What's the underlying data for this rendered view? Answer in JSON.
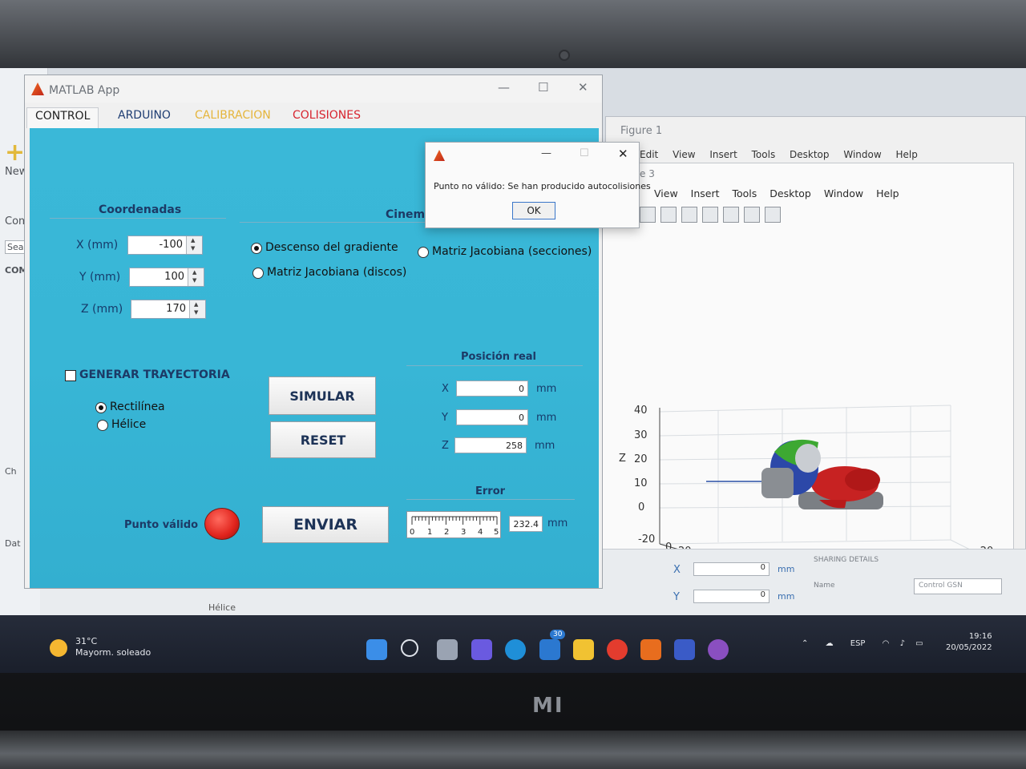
{
  "app": {
    "title": "MATLAB App",
    "tabs": [
      "CONTROL",
      "ARDUINO",
      "CALIBRACION",
      "COLISIONES"
    ],
    "coords": {
      "header": "Coordenadas",
      "x_label": "X (mm)",
      "x_value": "-100",
      "y_label": "Y (mm)",
      "y_value": "100",
      "z_label": "Z (mm)",
      "z_value": "170"
    },
    "cinematica": {
      "header": "Cinema",
      "opt1": "Descenso del gradiente",
      "opt2": "Matriz Jacobiana (discos)",
      "opt3": "Matriz Jacobiana (secciones)"
    },
    "trayectoria": {
      "label": "GENERAR TRAYECTORIA",
      "opt1": "Rectilínea",
      "opt2": "Hélice"
    },
    "buttons": {
      "simular": "SIMULAR",
      "reset": "RESET",
      "enviar": "ENVIAR"
    },
    "posicion": {
      "header": "Posición real",
      "x_label": "X",
      "x_value": "0",
      "y_label": "Y",
      "y_value": "0",
      "z_label": "Z",
      "z_value": "258",
      "unit": "mm"
    },
    "error": {
      "header": "Error",
      "value": "232.4",
      "unit": "mm",
      "ticks": [
        "0",
        "1",
        "2",
        "3",
        "4",
        "5"
      ]
    },
    "punto_valido": "Punto válido",
    "led_color": "#e0231c"
  },
  "dialog": {
    "message": "Punto no válido: Se han producido autocolisiones",
    "ok": "OK"
  },
  "figure1": {
    "title": "Figure 1",
    "menu": [
      "Edit",
      "View",
      "Insert",
      "Tools",
      "Desktop",
      "Window",
      "Help"
    ]
  },
  "figure3": {
    "title_fragment": "e 3",
    "menu": [
      "View",
      "Insert",
      "Tools",
      "Desktop",
      "Window",
      "Help"
    ],
    "axes": {
      "z_label": "Z",
      "y_label": "Y",
      "x_label": "X",
      "z_ticks": [
        "40",
        "30",
        "20",
        "10",
        "0",
        "-20"
      ],
      "y_ticks": [
        "0",
        "20",
        "40",
        "60",
        "80"
      ],
      "x_ticks": [
        "60",
        "40",
        "20",
        "0",
        "-20"
      ]
    }
  },
  "bg_desktop": {
    "new": "New",
    "com": "Com",
    "search": "Searc",
    "com2": "COM",
    "ch": "Ch",
    "dat": "Dat"
  },
  "lower_panel": {
    "x_label": "X",
    "x_value": "0",
    "y_label": "Y",
    "y_value": "0",
    "unit": "mm",
    "sharing": "SHARING DETAILS",
    "name_label": "Name",
    "name_value": "Control GSN",
    "helice": "Hélice"
  },
  "taskbar": {
    "temp": "31°C",
    "weather": "Mayorm. soleado",
    "badge": "30",
    "lang": "ESP",
    "time": "19:16",
    "date": "20/05/2022"
  },
  "brand": "mi"
}
